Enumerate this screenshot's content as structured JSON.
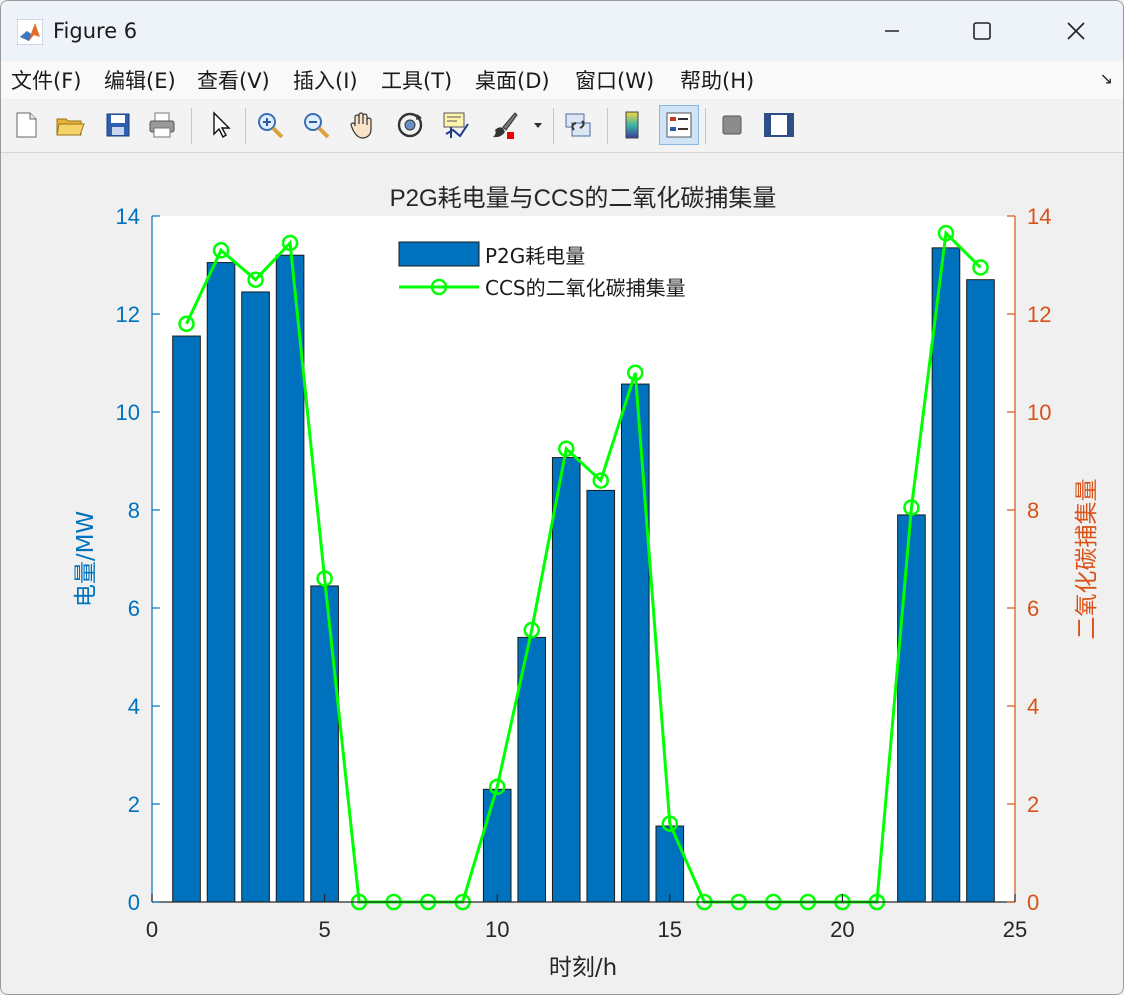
{
  "window": {
    "title": "Figure 6"
  },
  "menu": [
    "文件(F)",
    "编辑(E)",
    "查看(V)",
    "插入(I)",
    "工具(T)",
    "桌面(D)",
    "窗口(W)",
    "帮助(H)"
  ],
  "toolbar": [
    {
      "icon": "new-figure-icon"
    },
    {
      "icon": "open-file-icon"
    },
    {
      "icon": "save-icon"
    },
    {
      "icon": "print-icon"
    },
    {
      "icon": "select-arrow-icon"
    },
    {
      "icon": "zoom-in-icon"
    },
    {
      "icon": "zoom-out-icon"
    },
    {
      "icon": "pan-hand-icon"
    },
    {
      "icon": "rotate-3d-icon"
    },
    {
      "icon": "data-cursor-icon"
    },
    {
      "icon": "brush-icon"
    },
    {
      "icon": "dropdown-arrow-icon"
    },
    {
      "icon": "link-plot-icon"
    },
    {
      "icon": "colorbar-icon"
    },
    {
      "icon": "legend-icon"
    },
    {
      "icon": "hide-plot-tools-icon"
    },
    {
      "icon": "show-plot-tools-icon"
    }
  ],
  "chart_data": {
    "type": "bar",
    "title": "P2G耗电量与CCS的二氧化碳捕集量",
    "xlabel": "时刻/h",
    "ylabel_left": "电量/MW",
    "ylabel_right": "二氧化碳捕集量",
    "xlim": [
      0,
      25
    ],
    "ylim_left": [
      0,
      14
    ],
    "ylim_right": [
      0,
      14
    ],
    "xticks": [
      0,
      5,
      10,
      15,
      20,
      25
    ],
    "yticks": [
      0,
      2,
      4,
      6,
      8,
      10,
      12,
      14
    ],
    "legend_position": "top-center",
    "grid": false,
    "x": [
      1,
      2,
      3,
      4,
      5,
      6,
      7,
      8,
      9,
      10,
      11,
      12,
      13,
      14,
      15,
      16,
      17,
      18,
      19,
      20,
      21,
      22,
      23,
      24
    ],
    "series": [
      {
        "name": "P2G耗电量",
        "type": "bar",
        "axis": "left",
        "color": "#0072bd",
        "values": [
          11.55,
          13.05,
          12.45,
          13.2,
          6.45,
          0,
          0,
          0,
          0,
          2.3,
          5.4,
          9.07,
          8.4,
          10.57,
          1.55,
          0,
          0,
          0,
          0,
          0,
          0,
          7.9,
          13.35,
          12.7
        ]
      },
      {
        "name": "CCS的二氧化碳捕集量",
        "type": "line",
        "axis": "right",
        "color": "#00ff00",
        "marker": "circle",
        "values": [
          11.8,
          13.3,
          12.7,
          13.45,
          6.6,
          0,
          0,
          0,
          0,
          2.35,
          5.55,
          9.25,
          8.6,
          10.8,
          1.6,
          0,
          0,
          0,
          0,
          0,
          0,
          8.05,
          13.65,
          12.95
        ]
      }
    ],
    "colors": {
      "left_axis": "#0072bd",
      "right_axis": "#d95319",
      "text": "#262626"
    }
  }
}
